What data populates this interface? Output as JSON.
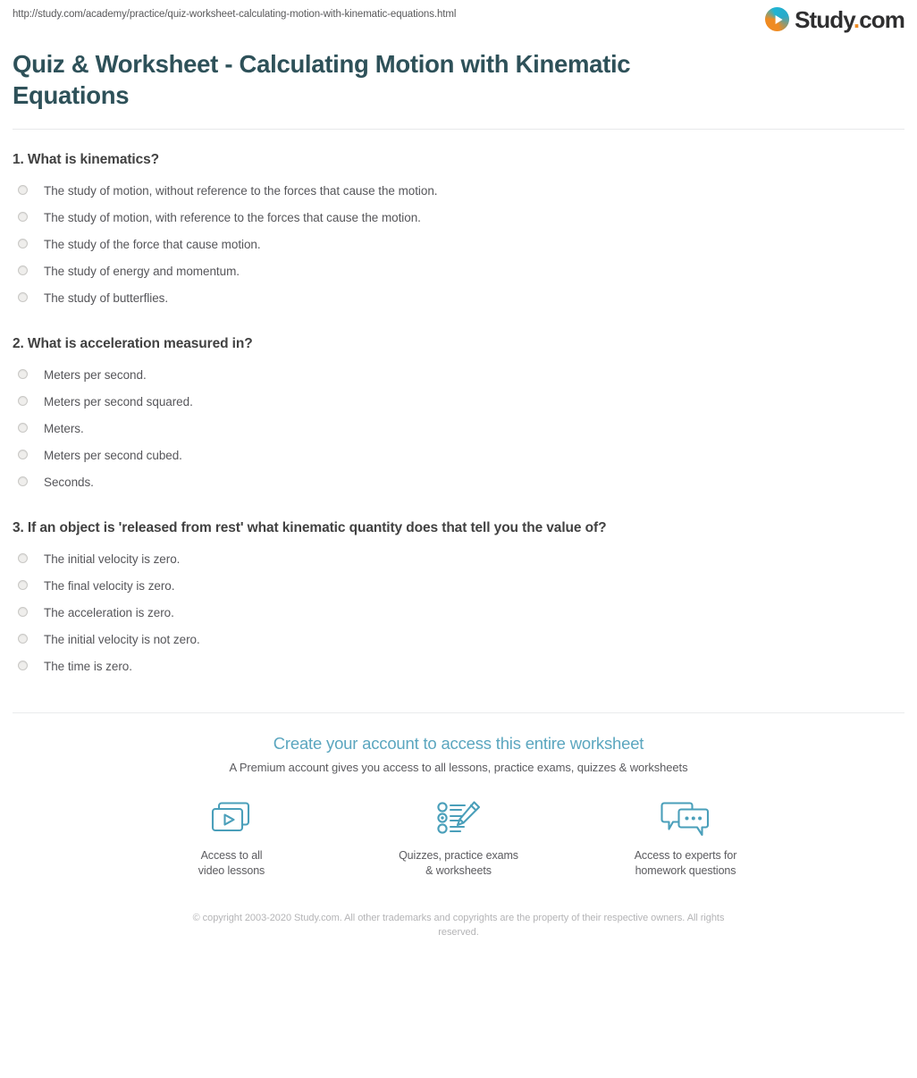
{
  "print_header": {
    "url": "http://study.com/academy/practice/quiz-worksheet-calculating-motion-with-kinematic-equations.html",
    "brand_name": "Study",
    "brand_dot": ".",
    "brand_tld": "com",
    "brand_icon": "play-circle-icon"
  },
  "page_title": "Quiz & Worksheet - Calculating Motion with Kinematic Equations",
  "questions": [
    {
      "number": "1.",
      "text": "1. What is kinematics?",
      "answers": [
        "The study of motion, without reference to the forces that cause the motion.",
        "The study of motion, with reference to the forces that cause the motion.",
        "The study of the force that cause motion.",
        "The study of energy and momentum.",
        "The study of butterflies."
      ]
    },
    {
      "number": "2.",
      "text": "2. What is acceleration measured in?",
      "answers": [
        "Meters per second.",
        "Meters per second squared.",
        "Meters.",
        "Meters per second cubed.",
        "Seconds."
      ]
    },
    {
      "number": "3.",
      "text": "3. If an object is 'released from rest' what kinematic quantity does that tell you the value of?",
      "answers": [
        "The initial velocity is zero.",
        "The final velocity is zero.",
        "The acceleration is zero.",
        "The initial velocity is not zero.",
        "The time is zero."
      ]
    }
  ],
  "cta": {
    "heading": "Create your account to access this entire worksheet",
    "subheading": "A Premium account gives you access to all lessons, practice exams, quizzes & worksheets",
    "features": [
      {
        "icon": "video-lessons-icon",
        "label": "Access to all\nvideo lessons"
      },
      {
        "icon": "quiz-pencil-icon",
        "label": "Quizzes, practice exams\n& worksheets"
      },
      {
        "icon": "chat-bubbles-icon",
        "label": "Access to experts for\nhomework questions"
      }
    ]
  },
  "footer": {
    "copyright": "© copyright 2003-2020 Study.com. All other trademarks and copyrights are the property of their respective owners. All rights reserved."
  },
  "colors": {
    "title": "#2e5159",
    "cta_heading": "#5ba6bf",
    "icon_teal": "#4a9fba",
    "brand_orange": "#ef8b22",
    "brand_teal": "#1eb5d4"
  }
}
